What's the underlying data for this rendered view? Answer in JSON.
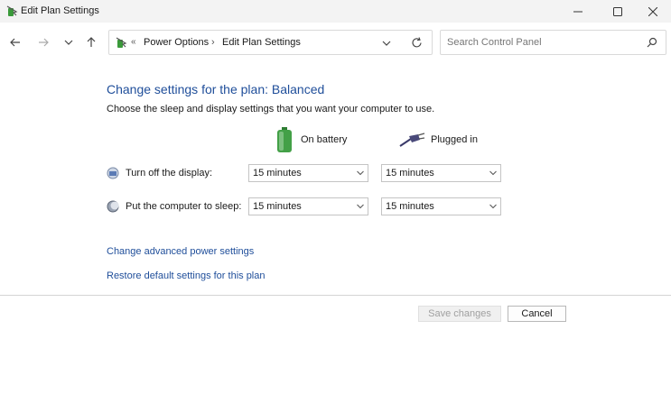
{
  "window": {
    "title": "Edit Plan Settings"
  },
  "address": {
    "separator": "«",
    "crumbs": [
      "Power Options",
      "Edit Plan Settings"
    ],
    "sub": "›"
  },
  "search": {
    "placeholder": "Search Control Panel"
  },
  "main": {
    "heading": "Change settings for the plan: Balanced",
    "description": "Choose the sleep and display settings that you want your computer to use.",
    "columns": {
      "battery": "On battery",
      "plugged": "Plugged in"
    },
    "rows": [
      {
        "label": "Turn off the display:",
        "battery": "15 minutes",
        "plugged": "15 minutes"
      },
      {
        "label": "Put the computer to sleep:",
        "battery": "15 minutes",
        "plugged": "15 minutes"
      }
    ],
    "links": {
      "advanced": "Change advanced power settings",
      "restore": "Restore default settings for this plan"
    }
  },
  "buttons": {
    "save": "Save changes",
    "cancel": "Cancel"
  },
  "colors": {
    "heading": "#1f4e9a",
    "link": "#1f4e9a"
  }
}
